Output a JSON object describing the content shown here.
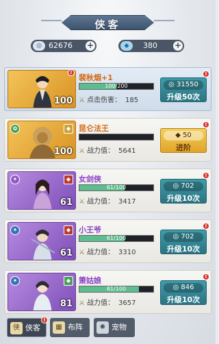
{
  "header": {
    "title": "侠客"
  },
  "currency": [
    {
      "icon": "silver-coin-icon",
      "value": "62676",
      "plus": "+"
    },
    {
      "icon": "jade-gem-icon",
      "value": "380",
      "plus": "+"
    }
  ],
  "heroes": [
    {
      "name": "裴秋烟+1",
      "level": "100",
      "bar_text": "100/200",
      "bar_fraction": 0.5,
      "stat_label": "点击伤害：",
      "stat_value": "185",
      "btn_cost": "31550",
      "btn_label": "升级50次",
      "btn_style": "teal",
      "portrait": "gold"
    },
    {
      "name": "昆仑法王",
      "level": "100",
      "bar_text": "",
      "bar_fraction": 0,
      "stat_label": "战力值：",
      "stat_value": "5641",
      "btn_cost": "50",
      "btn_label": "进阶",
      "btn_style": "gold",
      "portrait": "gold"
    },
    {
      "name": "女剑侠",
      "level": "61",
      "bar_text": "61/100",
      "bar_fraction": 0.61,
      "stat_label": "战力值：",
      "stat_value": "3417",
      "btn_cost": "702",
      "btn_label": "升级10次",
      "btn_style": "teal",
      "portrait": "purple"
    },
    {
      "name": "小王爷",
      "level": "61",
      "bar_text": "61/100",
      "bar_fraction": 0.61,
      "stat_label": "战力值：",
      "stat_value": "3310",
      "btn_cost": "702",
      "btn_label": "升级10次",
      "btn_style": "teal",
      "portrait": "purple"
    },
    {
      "name": "箫姑娘",
      "level": "81",
      "bar_text": "81/100",
      "bar_fraction": 0.81,
      "stat_label": "战力值：",
      "stat_value": "3657",
      "btn_cost": "846",
      "btn_label": "升级10次",
      "btn_style": "teal",
      "portrait": "purple"
    }
  ],
  "tabs": [
    {
      "label": "侠客",
      "icon": "hero-tab-icon"
    },
    {
      "label": "布阵",
      "icon": "formation-tab-icon"
    },
    {
      "label": "宠物",
      "icon": "pet-tab-icon"
    }
  ],
  "colors": {
    "teal_button": "#3f9ca9",
    "gold_button": "#e0a528",
    "progress_fill": "#5ebd8e",
    "alert_dot": "#d8332c"
  }
}
